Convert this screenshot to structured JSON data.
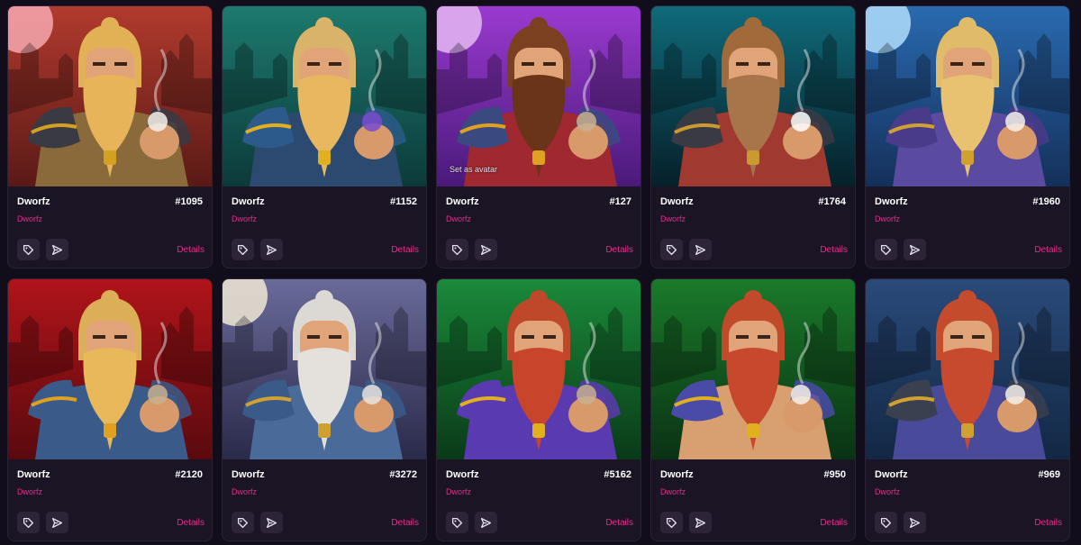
{
  "cards": [
    {
      "name": "Dworfz",
      "token": "#1095",
      "collection": "Dworfz",
      "details": "Details",
      "bg_top": "#b23a2e",
      "bg_bottom": "#5a1a16",
      "moon": "#f2a2a8",
      "beard": "#e8b45a",
      "hair": "#e2b055",
      "armor": "#3a3a44",
      "trim": "#d4a020",
      "shirt": "#8a6a3a",
      "accent": "#f4f0ea"
    },
    {
      "name": "Dworfz",
      "token": "#1152",
      "collection": "Dworfz",
      "details": "Details",
      "bg_top": "#1d7a6e",
      "bg_bottom": "#0c3a3a",
      "moon": "",
      "beard": "#e8b860",
      "hair": "#d9b36a",
      "armor": "#2c5a8a",
      "trim": "#e0b020",
      "shirt": "#2c4a70",
      "accent": "#7a4ad0"
    },
    {
      "name": "Dworfz",
      "token": "#127",
      "collection": "Dworfz",
      "details": "Details",
      "avatar_hint": "Set as avatar",
      "bg_top": "#9a3ad0",
      "bg_bottom": "#4a1a7a",
      "moon": "#e0b0f0",
      "beard": "#6a3418",
      "hair": "#7a4020",
      "armor": "#3a4a80",
      "trim": "#e0a020",
      "shirt": "#a02830",
      "accent": "#c8b090"
    },
    {
      "name": "Dworfz",
      "token": "#1764",
      "collection": "Dworfz",
      "details": "Details",
      "bg_top": "#0f6a7a",
      "bg_bottom": "#06202a",
      "moon": "",
      "beard": "#a8744a",
      "hair": "#a06a3a",
      "armor": "#3a3a44",
      "trim": "#c89a30",
      "shirt": "#a03a30",
      "accent": "#ffffff"
    },
    {
      "name": "Dworfz",
      "token": "#1960",
      "collection": "Dworfz",
      "details": "Details",
      "bg_top": "#2a6ab0",
      "bg_bottom": "#14305a",
      "moon": "#a8d8f8",
      "beard": "#e8c270",
      "hair": "#e0bc6a",
      "armor": "#4a3a8a",
      "trim": "#d0a030",
      "shirt": "#5a4aa0",
      "accent": "#f4f0ea"
    },
    {
      "name": "Dworfz",
      "token": "#2120",
      "collection": "Dworfz",
      "details": "Details",
      "bg_top": "#b0141a",
      "bg_bottom": "#5a0a0e",
      "moon": "",
      "beard": "#e8b85a",
      "hair": "#dcae58",
      "armor": "#3a5a8a",
      "trim": "#e0a020",
      "shirt": "#3a5a8a",
      "accent": "#c8b090"
    },
    {
      "name": "Dworfz",
      "token": "#3272",
      "collection": "Dworfz",
      "details": "Details",
      "bg_top": "#6a6a9a",
      "bg_bottom": "#2a2a4a",
      "moon": "#e8e0d0",
      "beard": "#e4e0dc",
      "hair": "#dcd8d4",
      "armor": "#3a5a8a",
      "trim": "#d0a030",
      "shirt": "#4a6a9a",
      "accent": "#e8e4e0"
    },
    {
      "name": "Dworfz",
      "token": "#5162",
      "collection": "Dworfz",
      "details": "Details",
      "bg_top": "#1a8a3a",
      "bg_bottom": "#0a3a18",
      "moon": "",
      "beard": "#c8442a",
      "hair": "#c0482a",
      "armor": "#5a3ab0",
      "trim": "#e0b020",
      "shirt": "#5a3ab0",
      "accent": "#c8b090"
    },
    {
      "name": "Dworfz",
      "token": "#950",
      "collection": "Dworfz",
      "details": "Details",
      "bg_top": "#1a7a2a",
      "bg_bottom": "#0a3214",
      "moon": "",
      "beard": "#c8482e",
      "hair": "#c04a2a",
      "armor": "#4a4aa8",
      "trim": "#e0b020",
      "shirt": "#d8a070",
      "accent": "#f4f0ea"
    },
    {
      "name": "Dworfz",
      "token": "#969",
      "collection": "Dworfz",
      "details": "Details",
      "bg_top": "#2a4a7a",
      "bg_bottom": "#122844",
      "moon": "",
      "beard": "#c84a2e",
      "hair": "#c44c2c",
      "armor": "#3a4050",
      "trim": "#d0a030",
      "shirt": "#4a4a9a",
      "accent": "#f4f0ea"
    }
  ],
  "icons": {
    "tag": "tag-icon",
    "send": "send-icon"
  }
}
